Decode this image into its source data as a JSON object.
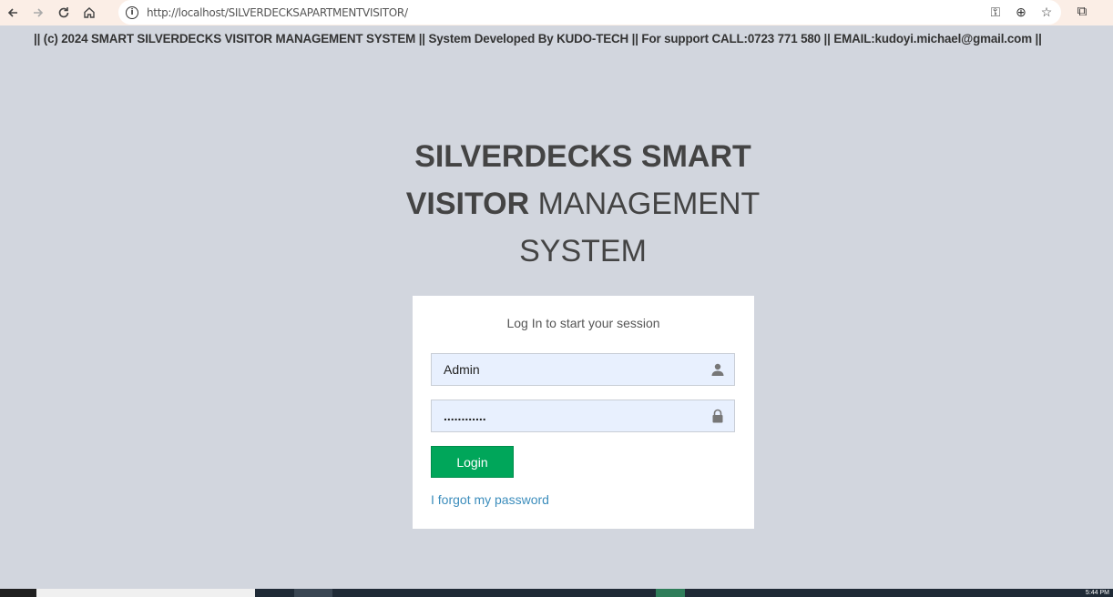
{
  "browser": {
    "url": "http://localhost/SILVERDECKSAPARTMENTVISITOR/"
  },
  "top_info": "|| (c) 2024 SMART SILVERDECKS VISITOR MANAGEMENT SYSTEM || System Developed By KUDO-TECH || For support CALL:0723 771 580 || EMAIL:kudoyi.michael@gmail.com ||",
  "logo": {
    "line1": "SILVERDECKS SMART",
    "line2_bold": "VISITOR",
    "line2_light": " MANAGEMENT",
    "line3": "SYSTEM"
  },
  "login": {
    "message": "Log In to start your session",
    "username_value": "Admin",
    "password_value": "............",
    "button_label": "Login",
    "forgot_link": "I forgot my password"
  },
  "taskbar": {
    "clock": "5:44 PM"
  },
  "colors": {
    "page_bg": "#d2d6de",
    "login_button": "#00a65a",
    "link": "#3c8dbc",
    "input_bg": "#e8f0fe"
  }
}
